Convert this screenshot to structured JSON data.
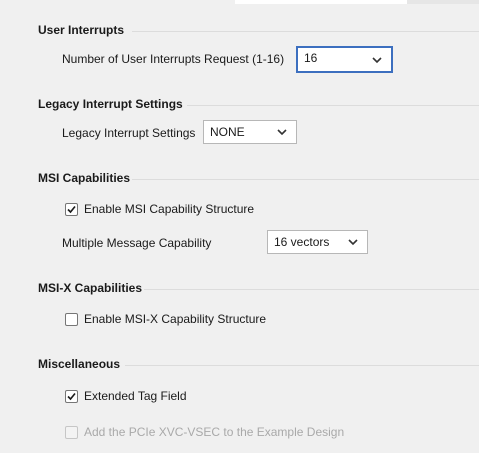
{
  "user_interrupts": {
    "title": "User Interrupts",
    "request_label": "Number of User Interrupts Request (1-16)",
    "request_value": "16"
  },
  "legacy": {
    "title": "Legacy Interrupt Settings",
    "settings_label": "Legacy Interrupt Settings",
    "settings_value": "NONE"
  },
  "msi": {
    "title": "MSI Capabilities",
    "enable_label": "Enable MSI Capability Structure",
    "enable_checked": true,
    "multiple_label": "Multiple Message Capability",
    "multiple_value": "16 vectors"
  },
  "msix": {
    "title": "MSI-X Capabilities",
    "enable_label": "Enable MSI-X Capability Structure",
    "enable_checked": false
  },
  "misc": {
    "title": "Miscellaneous",
    "extended_tag_label": "Extended Tag Field",
    "extended_tag_checked": true,
    "xvc_label": "Add the PCIe XVC-VSEC to the Example Design",
    "xvc_checked": false,
    "xvc_enabled": false
  },
  "icons": {
    "dropdown": "chevron-down-icon",
    "check": "checkmark-icon"
  },
  "colors": {
    "focus_border": "#3c6fbf",
    "background": "#f0f0f0"
  }
}
